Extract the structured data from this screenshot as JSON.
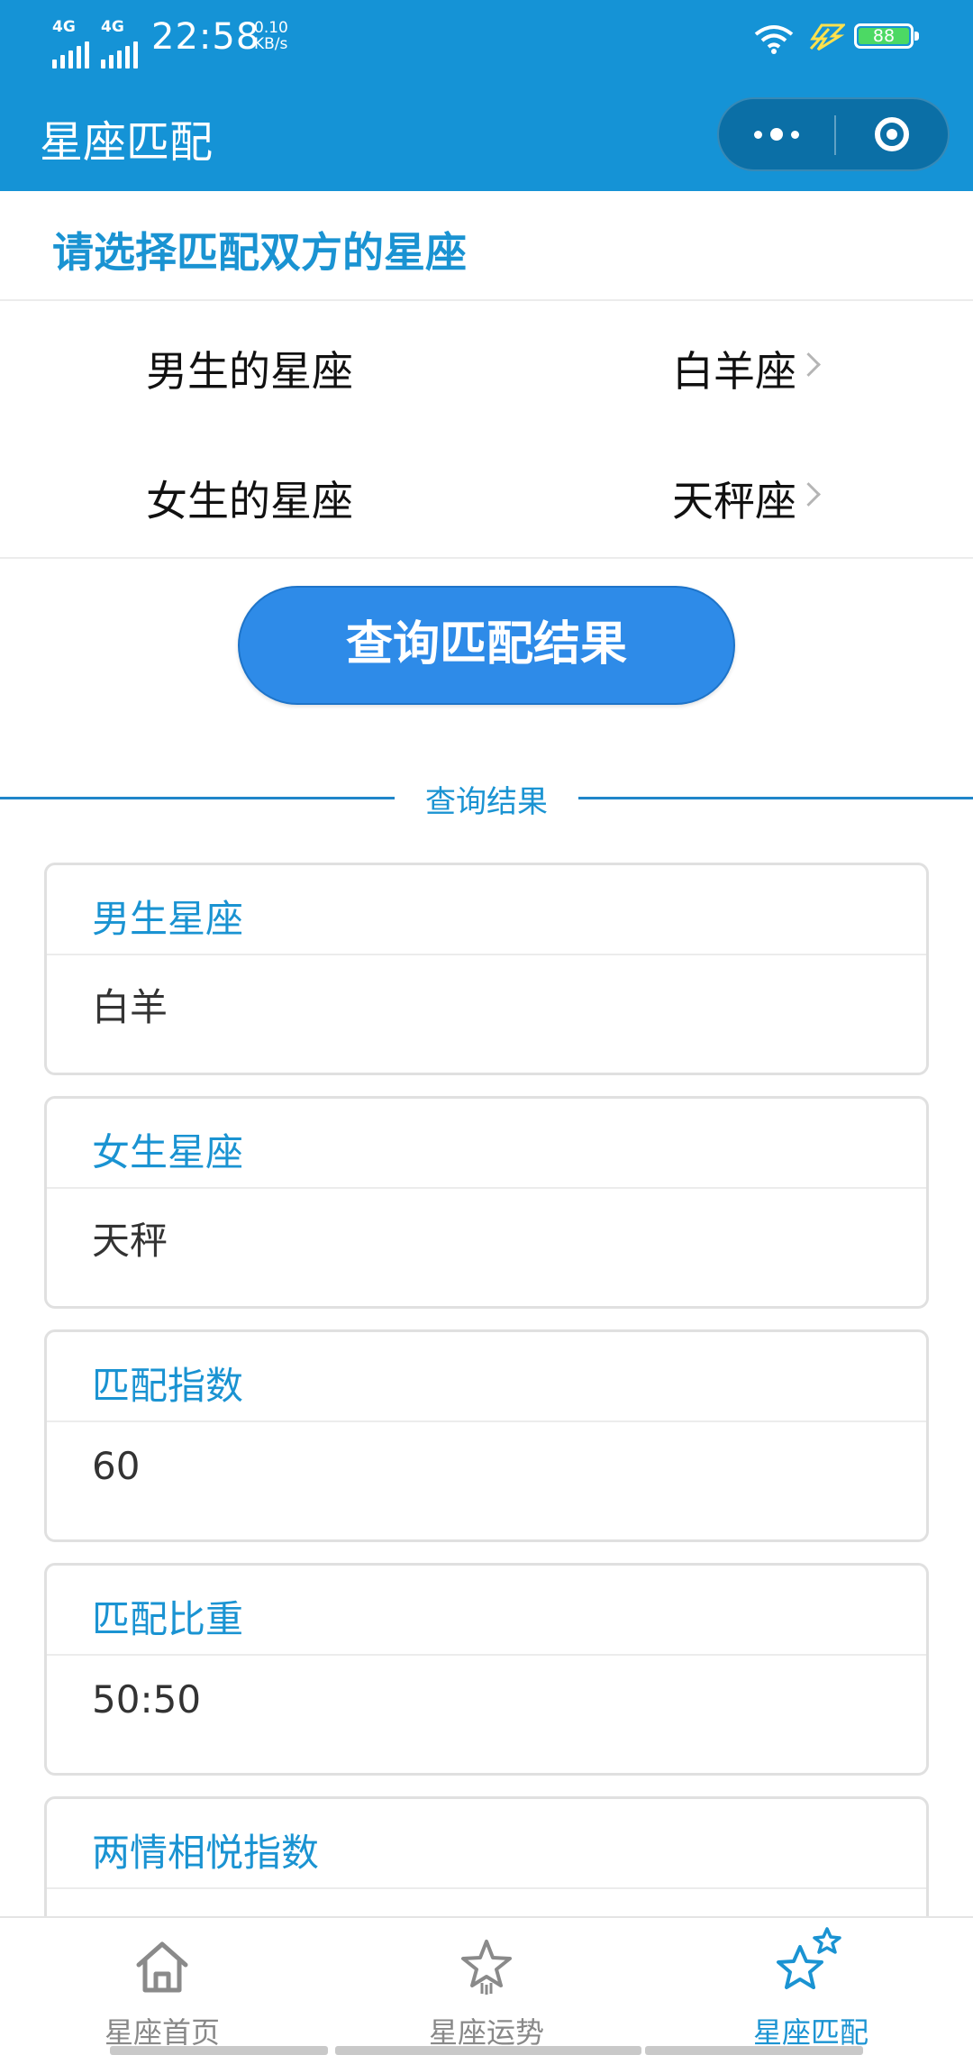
{
  "status_bar": {
    "network1": "4G",
    "network2": "4G",
    "time": "22:58",
    "speed_value": "0.10",
    "speed_unit": "KB/s",
    "battery": "88",
    "icons": [
      "signal-icon",
      "signal-icon",
      "wifi-icon",
      "charging-icon",
      "battery-icon"
    ]
  },
  "nav": {
    "title": "星座匹配",
    "more_icon": "more-dots-icon",
    "close_icon": "close-circle-icon",
    "bar_color": "#1593d6"
  },
  "select": {
    "heading": "请选择匹配双方的星座",
    "male_label": "男生的星座",
    "male_value": "白羊座",
    "female_label": "女生的星座",
    "female_value": "天秤座",
    "chevron_icon": "chevron-right-icon"
  },
  "query_button": "查询匹配结果",
  "results": {
    "divider": "查询结果",
    "cards": [
      {
        "title": "男生星座",
        "value": "白羊"
      },
      {
        "title": "女生星座",
        "value": "天秤"
      },
      {
        "title": "匹配指数",
        "value": "60"
      },
      {
        "title": "匹配比重",
        "value": "50:50"
      },
      {
        "title": "两情相悦指数",
        "value": ""
      }
    ]
  },
  "tabbar": {
    "tabs": [
      {
        "label": "星座首页",
        "icon": "home-icon",
        "active": false
      },
      {
        "label": "星座运势",
        "icon": "star-icon",
        "active": false
      },
      {
        "label": "星座匹配",
        "icon": "double-star-icon",
        "active": true
      }
    ]
  },
  "colors": {
    "accent": "#1a93d2",
    "button": "#2e8be8"
  }
}
